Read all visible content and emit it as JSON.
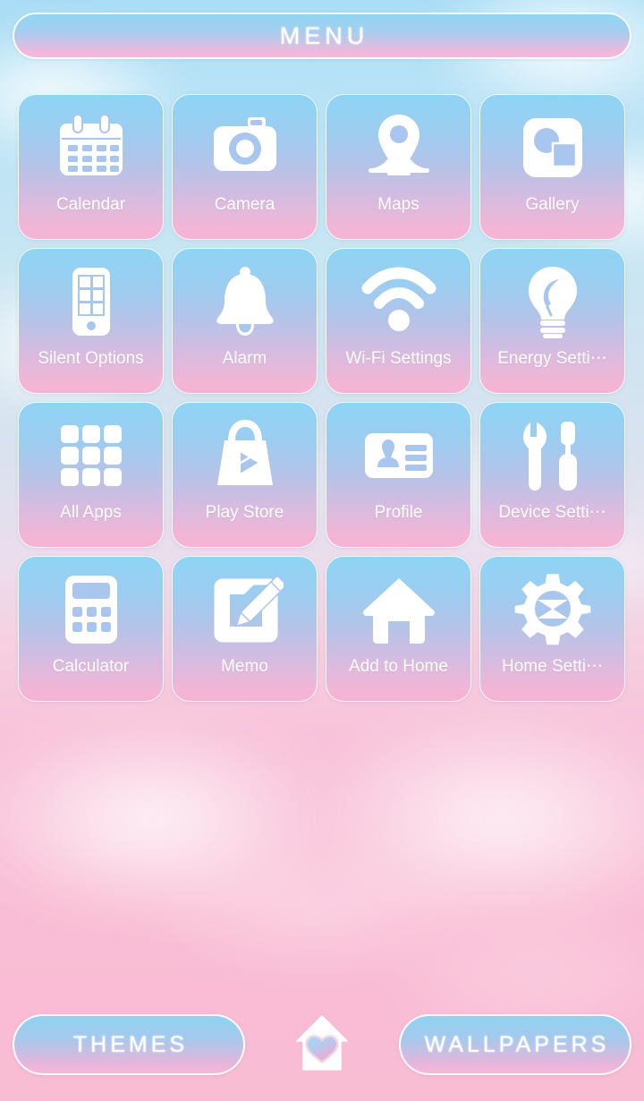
{
  "header": {
    "title": "MENU"
  },
  "apps": [
    {
      "label": "Calendar",
      "icon": "calendar-icon"
    },
    {
      "label": "Camera",
      "icon": "camera-icon"
    },
    {
      "label": "Maps",
      "icon": "map-pin-icon"
    },
    {
      "label": "Gallery",
      "icon": "gallery-icon"
    },
    {
      "label": "Silent Options",
      "icon": "phone-grid-icon"
    },
    {
      "label": "Alarm",
      "icon": "bell-icon"
    },
    {
      "label": "Wi-Fi Settings",
      "icon": "wifi-icon"
    },
    {
      "label": "Energy Setti⋯",
      "icon": "lightbulb-leaf-icon"
    },
    {
      "label": "All Apps",
      "icon": "app-drawer-grid-icon"
    },
    {
      "label": "Play Store",
      "icon": "shopping-bag-play-icon"
    },
    {
      "label": "Profile",
      "icon": "id-card-icon"
    },
    {
      "label": "Device Setti⋯",
      "icon": "wrench-screwdriver-icon"
    },
    {
      "label": "Calculator",
      "icon": "calculator-icon"
    },
    {
      "label": "Memo",
      "icon": "note-pencil-icon"
    },
    {
      "label": "Add to Home",
      "icon": "house-icon"
    },
    {
      "label": "Home Setti⋯",
      "icon": "gear-icon"
    }
  ],
  "bottom_bar": {
    "themes_label": "THEMES",
    "wallpapers_label": "WALLPAPERS",
    "home_icon": "house-heart-icon"
  },
  "colors": {
    "tile_gradient_top": "#8ed4f5",
    "tile_gradient_bottom": "#f7b3d3",
    "icon_white": "#ffffff",
    "icon_accent_blue": "#a9c6ee",
    "label_white": "#ffffff",
    "wallpaper_sky": "#a9ddf5",
    "wallpaper_pink": "#f8bcd3"
  }
}
